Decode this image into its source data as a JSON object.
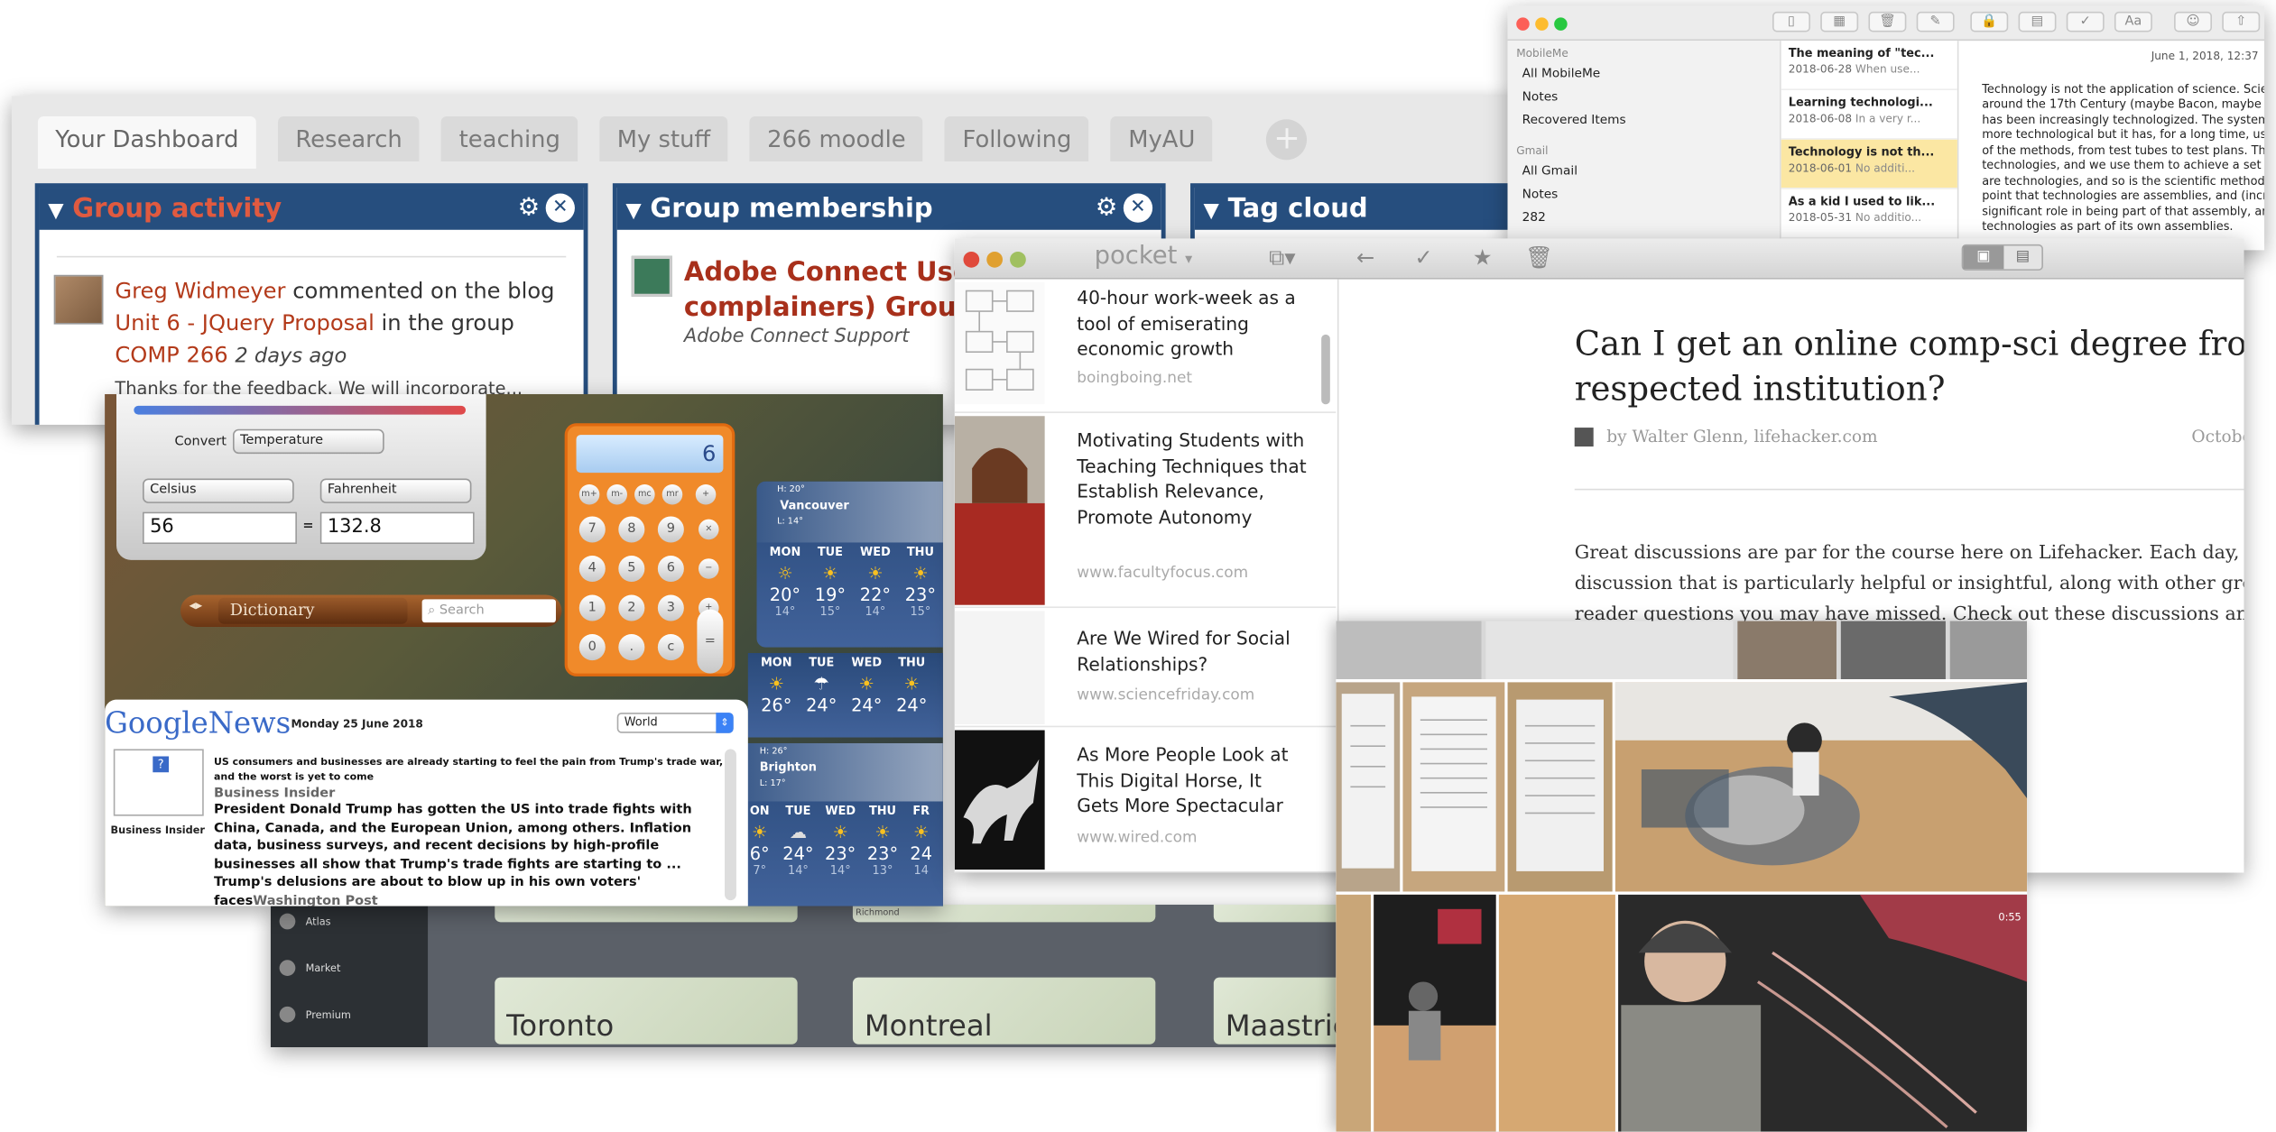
{
  "dashboard": {
    "tabs": [
      "Your Dashboard",
      "Research",
      "teaching",
      "My stuff",
      "266 moodle",
      "Following",
      "MyAU"
    ],
    "add_tab": "+",
    "group_activity": {
      "title": "Group activity",
      "user": "Greg Widmeyer",
      "t1": " commented on the blog ",
      "post": "Unit 6 - JQuery Proposal",
      "t2": " in the group ",
      "group": "COMP 266",
      "ago": "2 days ago",
      "preview": "Thanks for the feedback. We will incorporate..."
    },
    "group_membership": {
      "title": "Group membership",
      "group_title": "Adobe Connect Users (and complainers) Group",
      "sub": "Adobe Connect Support"
    },
    "tag_cloud": {
      "title": "Tag cloud"
    }
  },
  "notes": {
    "sections": [
      {
        "header": "MobileMe",
        "items": [
          "All MobileMe",
          "Notes",
          "Recovered Items"
        ]
      },
      {
        "header": "Gmail",
        "items": [
          "All Gmail",
          "Notes",
          "282"
        ]
      }
    ],
    "list": [
      {
        "title": "The meaning of \"tec...",
        "date": "2018-06-28",
        "preview": "When use..."
      },
      {
        "title": "Learning technologi...",
        "date": "2018-06-08",
        "preview": "In a very r..."
      },
      {
        "title": "Technology is not th...",
        "date": "2018-06-01",
        "preview": "No additi..."
      },
      {
        "title": "As a kid I used to lik...",
        "date": "2018-05-31",
        "preview": "No additio..."
      }
    ],
    "body_date": "June 1, 2018, 12:37",
    "body_lines": [
      "Technology is not the application of science. Scie",
      "around the 17th Century (maybe Bacon, maybe D",
      "has been increasingly technologized. The system",
      "more technological but it has, for a long time, use",
      "of the methods, from test tubes to test plans. The",
      "technologies, and we use them to achieve a set c",
      "are technologies, and so is the scientific method",
      "point that technologies are assemblies, and (incre",
      "significant role in being part of that assembly, and",
      "technologies as part of its own assemblies."
    ]
  },
  "widgets": {
    "converter": {
      "label": "Convert",
      "type": "Temperature",
      "from_unit": "Celsius",
      "to_unit": "Fahrenheit",
      "from_value": "56",
      "equals": "=",
      "to_value": "132.8"
    },
    "dictionary": {
      "source": "Dictionary",
      "search_placeholder": "Search"
    },
    "calculator": {
      "display": "6",
      "memory_keys": [
        "m+",
        "m-",
        "mc",
        "mr",
        "+"
      ],
      "keys": [
        "7",
        "8",
        "9",
        "4",
        "5",
        "6",
        "1",
        "2",
        "3",
        "0",
        ".",
        "c"
      ],
      "op_keys": [
        "×",
        "−",
        "+",
        "="
      ]
    },
    "weather": [
      {
        "city": "Vancouver",
        "high": "H: 20°",
        "low": "L: 14°",
        "days": [
          "MON",
          "TUE",
          "WED",
          "THU"
        ],
        "icons": [
          "☼",
          "☀",
          "☀",
          "☀"
        ],
        "highs": [
          "20°",
          "19°",
          "22°",
          "23°"
        ],
        "lows": [
          "14°",
          "15°",
          "14°",
          "15°"
        ]
      },
      {
        "city": "",
        "high": "",
        "low": "",
        "days": [
          "MON",
          "TUE",
          "WED",
          "THU"
        ],
        "icons": [
          "☀",
          "☂",
          "☀",
          "☀"
        ],
        "highs": [
          "26°",
          "24°",
          "24°",
          "24°"
        ],
        "lows": [
          "",
          "",
          "",
          ""
        ]
      },
      {
        "city": "Brighton",
        "high": "H: 26°",
        "low": "L: 17°",
        "days": [
          "ON",
          "TUE",
          "WED",
          "THU",
          "FR"
        ],
        "icons": [
          "☀",
          "☁",
          "☀",
          "☀",
          "☀"
        ],
        "highs": [
          "6°",
          "24°",
          "23°",
          "23°",
          "24"
        ],
        "lows": [
          "7°",
          "14°",
          "14°",
          "13°",
          "14"
        ]
      }
    ],
    "google_news": {
      "logo_google": "Google",
      "logo_news": "News",
      "date": "Monday 25 June 2018",
      "region": "World",
      "thumb_source": "Business Insider",
      "summary": "US consumers and businesses are already starting to feel the pain from Trump's trade war, and the worst is yet to come",
      "source": "Business Insider",
      "article": "President Donald Trump has gotten the US into trade fights with China, Canada, and the European Union, among others. Inflation data, business surveys, and recent decisions by high-profile businesses all show that Trump's trade fights are starting to ...",
      "next": "Trump's delusions are about to blow up in his own voters'",
      "next2": "faces",
      "next_source": "Washington Post"
    }
  },
  "map_app": {
    "side": [
      "Atlas",
      "Market",
      "Premium"
    ],
    "cities": [
      "Toronto",
      "Montreal",
      "Maastric"
    ],
    "top_label": "Richmond"
  },
  "pocket": {
    "logo": "pocket",
    "list": [
      {
        "title": "40-hour work-week as a tool of emiserating economic growth",
        "domain": "boingboing.net"
      },
      {
        "title": "Motivating Students with Teaching Techniques that Establish Relevance, Promote Autonomy",
        "domain": "www.facultyfocus.com"
      },
      {
        "title": "Are We Wired for Social Relationships?",
        "domain": "www.sciencefriday.com"
      },
      {
        "title": "As More People Look at This Digital Horse, It Gets More Spectacular",
        "domain": "www.wired.com"
      }
    ],
    "article": {
      "title1": "Can I get an online comp-sci degree from a",
      "title2": "respected institution?",
      "byline": "by Walter Glenn, lifehacker.com",
      "date": "October",
      "p1": "Great discussions are par for the course here on Lifehacker. Each day, we",
      "p2": "discussion that is particularly helpful or insightful, along with other great",
      "p3": "reader questions you may have missed. Check out these discussions and a"
    }
  },
  "photos": {
    "time": "0:55"
  },
  "colors": {
    "dashboard_blue": "#264e7e",
    "link_red": "#b33a1a",
    "notes_selected": "#fbe7a3",
    "calc_orange": "#f08a2a"
  }
}
